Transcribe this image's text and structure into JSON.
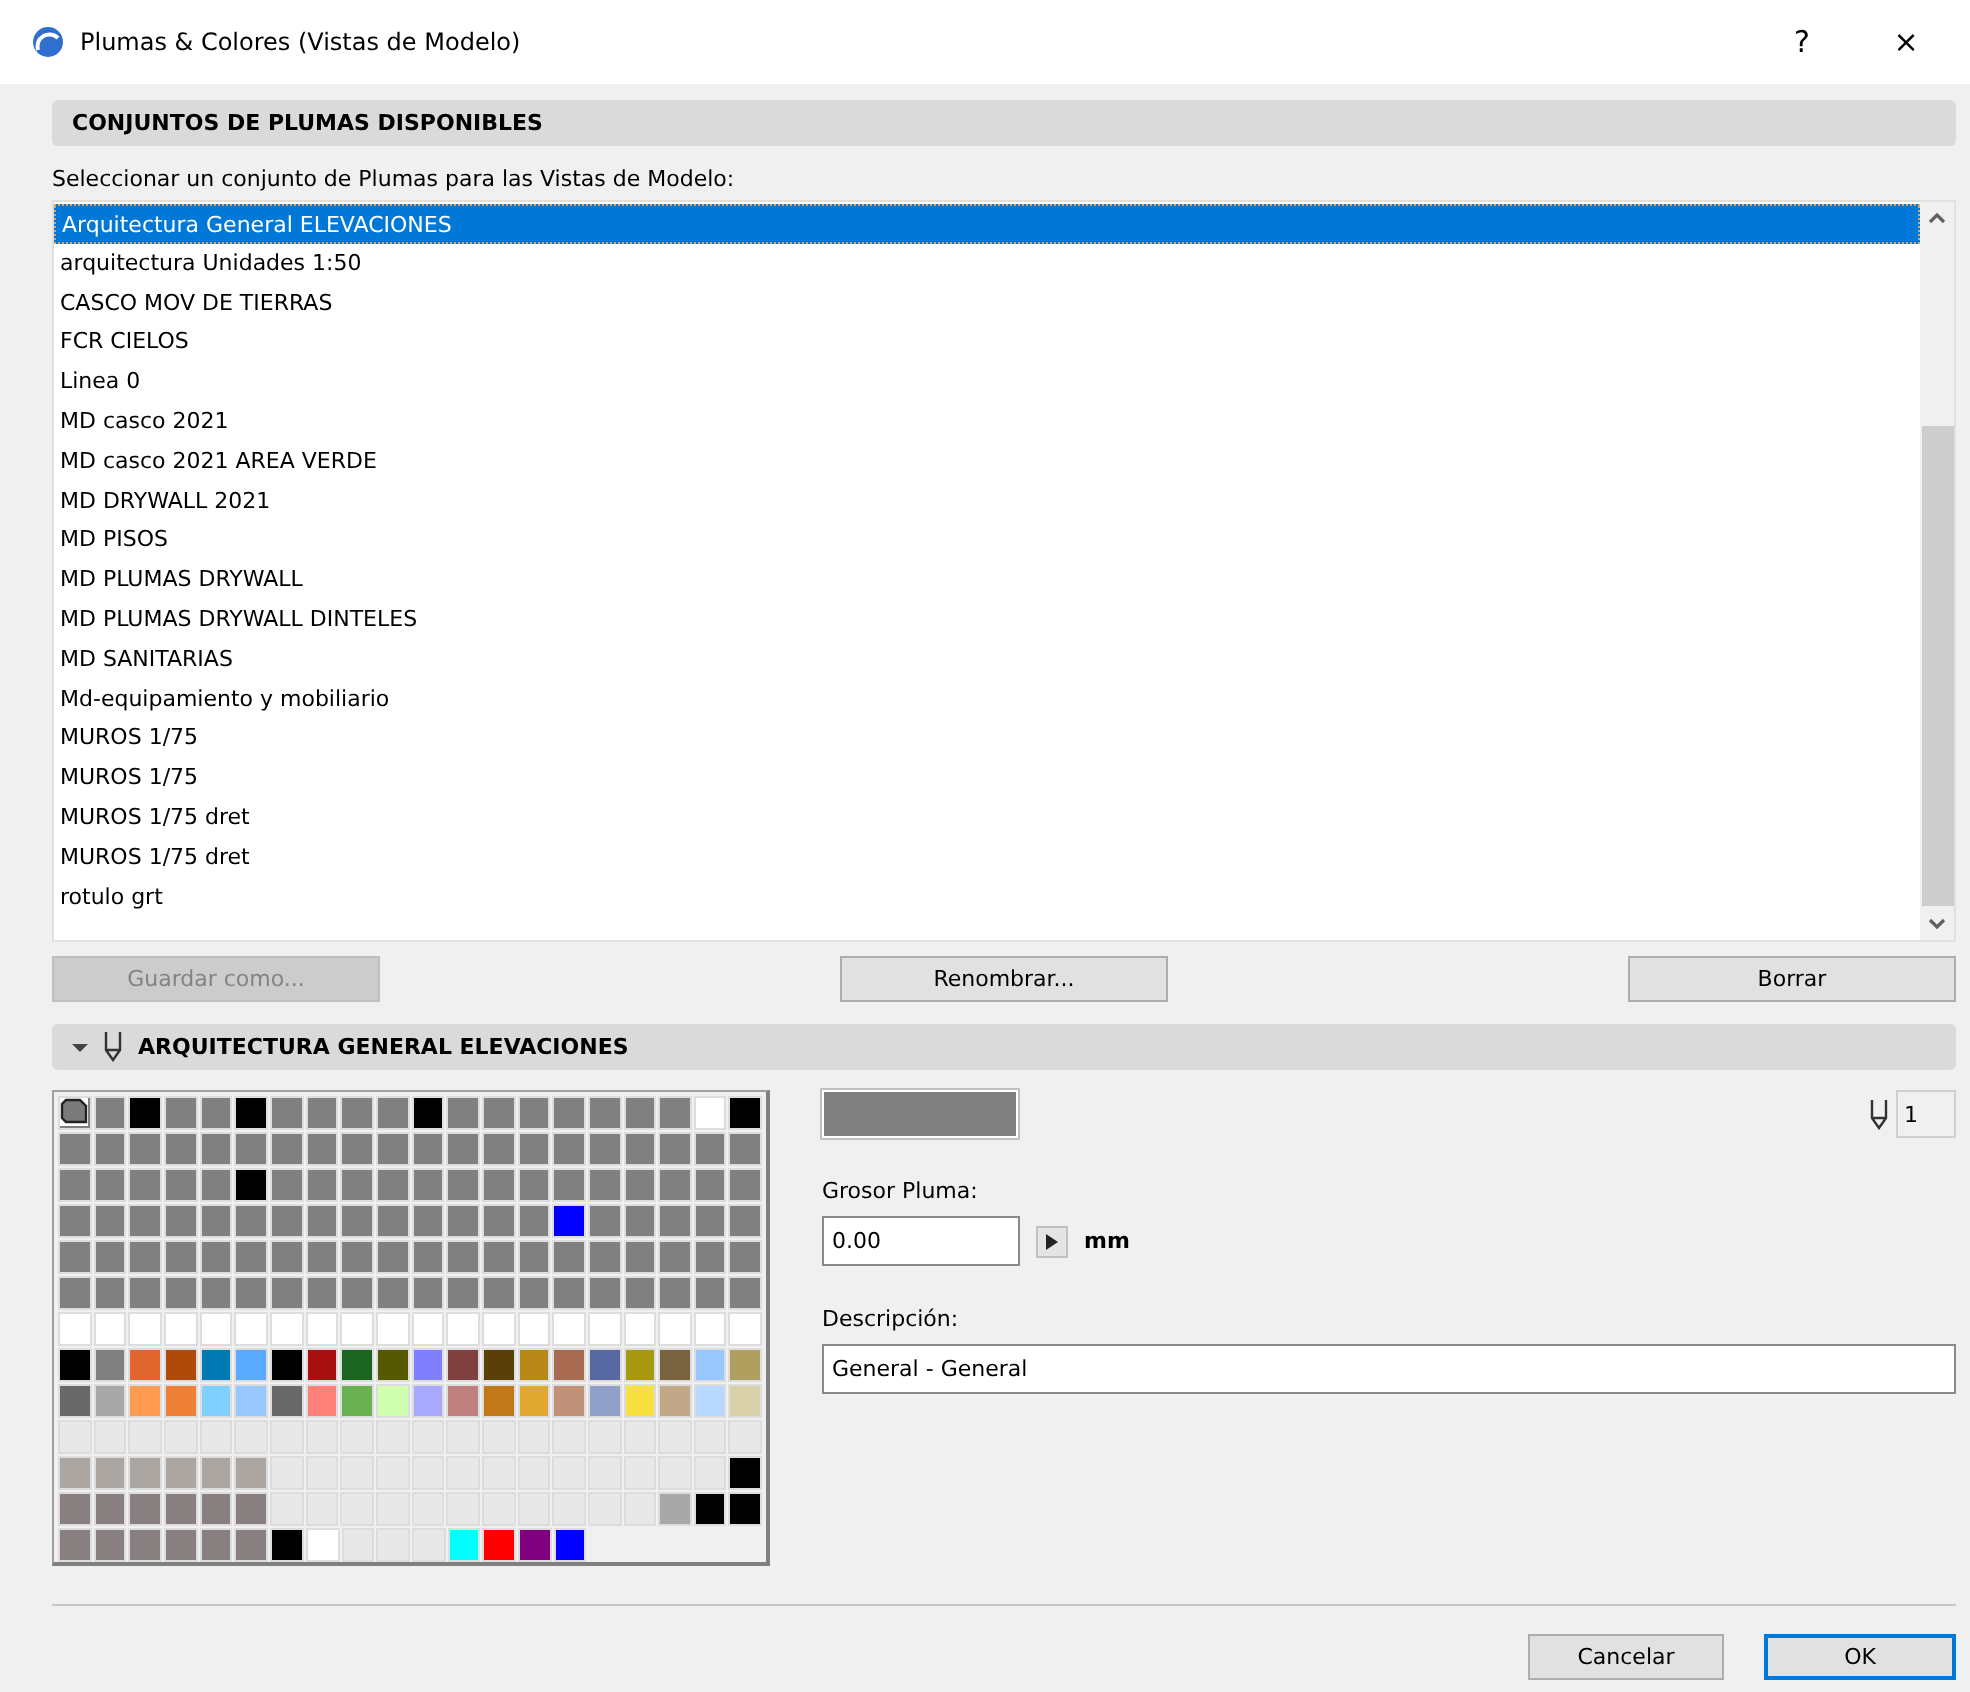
{
  "window": {
    "title": "Plumas & Colores (Vistas de Modelo)",
    "help": "?",
    "close": "×"
  },
  "sets_section": {
    "title": "CONJUNTOS DE PLUMAS DISPONIBLES",
    "prompt": "Seleccionar un conjunto de Plumas para las Vistas de Modelo:"
  },
  "pen_sets": [
    {
      "label": "Arquitectura General ELEVACIONES",
      "selected": true
    },
    {
      "label": "arquitectura Unidades 1:50",
      "selected": false
    },
    {
      "label": "CASCO MOV DE TIERRAS",
      "selected": false
    },
    {
      "label": "FCR CIELOS",
      "selected": false
    },
    {
      "label": "Linea 0",
      "selected": false
    },
    {
      "label": "MD casco 2021",
      "selected": false
    },
    {
      "label": "MD casco 2021 AREA VERDE",
      "selected": false
    },
    {
      "label": "MD DRYWALL 2021",
      "selected": false
    },
    {
      "label": "MD PISOS",
      "selected": false
    },
    {
      "label": "MD PLUMAS DRYWALL",
      "selected": false
    },
    {
      "label": "MD PLUMAS DRYWALL DINTELES",
      "selected": false
    },
    {
      "label": "MD SANITARIAS",
      "selected": false
    },
    {
      "label": "Md-equipamiento y mobiliario",
      "selected": false
    },
    {
      "label": "MUROS 1/75",
      "selected": false
    },
    {
      "label": "MUROS 1/75",
      "selected": false
    },
    {
      "label": "MUROS 1/75 dret",
      "selected": false
    },
    {
      "label": "MUROS 1/75 dret",
      "selected": false
    },
    {
      "label": "rotulo grt",
      "selected": false
    }
  ],
  "set_buttons": [
    {
      "label": "Guardar como...",
      "disabled": true
    },
    {
      "label": "Renombrar...",
      "disabled": false
    },
    {
      "label": "Borrar",
      "disabled": false
    }
  ],
  "pen_section": {
    "title": "ARQUITECTURA GENERAL ELEVACIONES",
    "expanded": true
  },
  "pen_palette": {
    "rows": [
      {
        "cells": [
          {
            "color": "#808080",
            "selected": true
          },
          {
            "color": "#808080",
            "selected": false
          },
          {
            "color": "#000000",
            "selected": false
          },
          {
            "color": "#808080",
            "selected": false
          },
          {
            "color": "#808080",
            "selected": false
          },
          {
            "color": "#000000",
            "selected": false
          },
          {
            "color": "#808080",
            "selected": false
          },
          {
            "color": "#808080",
            "selected": false
          },
          {
            "color": "#808080",
            "selected": false
          },
          {
            "color": "#808080",
            "selected": false
          },
          {
            "color": "#000000",
            "selected": false
          },
          {
            "color": "#808080",
            "selected": false
          },
          {
            "color": "#808080",
            "selected": false
          },
          {
            "color": "#808080",
            "selected": false
          },
          {
            "color": "#808080",
            "selected": false
          },
          {
            "color": "#808080",
            "selected": false
          },
          {
            "color": "#808080",
            "selected": false
          },
          {
            "color": "#808080",
            "selected": false
          },
          {
            "color": "#ffffff",
            "selected": false
          },
          {
            "color": "#000000",
            "selected": false
          }
        ]
      },
      {
        "cells": [
          {
            "color": "#808080",
            "selected": false
          },
          {
            "color": "#808080",
            "selected": false
          },
          {
            "color": "#808080",
            "selected": false
          },
          {
            "color": "#808080",
            "selected": false
          },
          {
            "color": "#808080",
            "selected": false
          },
          {
            "color": "#808080",
            "selected": false
          },
          {
            "color": "#808080",
            "selected": false
          },
          {
            "color": "#808080",
            "selected": false
          },
          {
            "color": "#808080",
            "selected": false
          },
          {
            "color": "#808080",
            "selected": false
          },
          {
            "color": "#808080",
            "selected": false
          },
          {
            "color": "#808080",
            "selected": false
          },
          {
            "color": "#808080",
            "selected": false
          },
          {
            "color": "#808080",
            "selected": false
          },
          {
            "color": "#808080",
            "selected": false
          },
          {
            "color": "#808080",
            "selected": false
          },
          {
            "color": "#808080",
            "selected": false
          },
          {
            "color": "#808080",
            "selected": false
          },
          {
            "color": "#808080",
            "selected": false
          },
          {
            "color": "#808080",
            "selected": false
          }
        ]
      },
      {
        "cells": [
          {
            "color": "#808080",
            "selected": false
          },
          {
            "color": "#808080",
            "selected": false
          },
          {
            "color": "#808080",
            "selected": false
          },
          {
            "color": "#808080",
            "selected": false
          },
          {
            "color": "#808080",
            "selected": false
          },
          {
            "color": "#000000",
            "selected": false
          },
          {
            "color": "#808080",
            "selected": false
          },
          {
            "color": "#808080",
            "selected": false
          },
          {
            "color": "#808080",
            "selected": false
          },
          {
            "color": "#808080",
            "selected": false
          },
          {
            "color": "#808080",
            "selected": false
          },
          {
            "color": "#808080",
            "selected": false
          },
          {
            "color": "#808080",
            "selected": false
          },
          {
            "color": "#808080",
            "selected": false
          },
          {
            "color": "#808080",
            "selected": false
          },
          {
            "color": "#808080",
            "selected": false
          },
          {
            "color": "#808080",
            "selected": false
          },
          {
            "color": "#808080",
            "selected": false
          },
          {
            "color": "#808080",
            "selected": false
          },
          {
            "color": "#808080",
            "selected": false
          }
        ]
      },
      {
        "cells": [
          {
            "color": "#808080",
            "selected": false
          },
          {
            "color": "#808080",
            "selected": false
          },
          {
            "color": "#808080",
            "selected": false
          },
          {
            "color": "#808080",
            "selected": false
          },
          {
            "color": "#808080",
            "selected": false
          },
          {
            "color": "#808080",
            "selected": false
          },
          {
            "color": "#808080",
            "selected": false
          },
          {
            "color": "#808080",
            "selected": false
          },
          {
            "color": "#808080",
            "selected": false
          },
          {
            "color": "#808080",
            "selected": false
          },
          {
            "color": "#808080",
            "selected": false
          },
          {
            "color": "#808080",
            "selected": false
          },
          {
            "color": "#808080",
            "selected": false
          },
          {
            "color": "#808080",
            "selected": false
          },
          {
            "color": "#0000ff",
            "selected": false
          },
          {
            "color": "#808080",
            "selected": false
          },
          {
            "color": "#808080",
            "selected": false
          },
          {
            "color": "#808080",
            "selected": false
          },
          {
            "color": "#808080",
            "selected": false
          },
          {
            "color": "#808080",
            "selected": false
          }
        ]
      },
      {
        "cells": [
          {
            "color": "#808080",
            "selected": false
          },
          {
            "color": "#808080",
            "selected": false
          },
          {
            "color": "#808080",
            "selected": false
          },
          {
            "color": "#808080",
            "selected": false
          },
          {
            "color": "#808080",
            "selected": false
          },
          {
            "color": "#808080",
            "selected": false
          },
          {
            "color": "#808080",
            "selected": false
          },
          {
            "color": "#808080",
            "selected": false
          },
          {
            "color": "#808080",
            "selected": false
          },
          {
            "color": "#808080",
            "selected": false
          },
          {
            "color": "#808080",
            "selected": false
          },
          {
            "color": "#808080",
            "selected": false
          },
          {
            "color": "#808080",
            "selected": false
          },
          {
            "color": "#808080",
            "selected": false
          },
          {
            "color": "#808080",
            "selected": false
          },
          {
            "color": "#808080",
            "selected": false
          },
          {
            "color": "#808080",
            "selected": false
          },
          {
            "color": "#808080",
            "selected": false
          },
          {
            "color": "#808080",
            "selected": false
          },
          {
            "color": "#808080",
            "selected": false
          }
        ]
      },
      {
        "cells": [
          {
            "color": "#808080",
            "selected": false
          },
          {
            "color": "#808080",
            "selected": false
          },
          {
            "color": "#808080",
            "selected": false
          },
          {
            "color": "#808080",
            "selected": false
          },
          {
            "color": "#808080",
            "selected": false
          },
          {
            "color": "#808080",
            "selected": false
          },
          {
            "color": "#808080",
            "selected": false
          },
          {
            "color": "#808080",
            "selected": false
          },
          {
            "color": "#808080",
            "selected": false
          },
          {
            "color": "#808080",
            "selected": false
          },
          {
            "color": "#808080",
            "selected": false
          },
          {
            "color": "#808080",
            "selected": false
          },
          {
            "color": "#808080",
            "selected": false
          },
          {
            "color": "#808080",
            "selected": false
          },
          {
            "color": "#808080",
            "selected": false
          },
          {
            "color": "#808080",
            "selected": false
          },
          {
            "color": "#808080",
            "selected": false
          },
          {
            "color": "#808080",
            "selected": false
          },
          {
            "color": "#808080",
            "selected": false
          },
          {
            "color": "#808080",
            "selected": false
          }
        ]
      },
      {
        "cells": [
          {
            "color": "#ffffff",
            "selected": false
          },
          {
            "color": "#ffffff",
            "selected": false
          },
          {
            "color": "#ffffff",
            "selected": false
          },
          {
            "color": "#ffffff",
            "selected": false
          },
          {
            "color": "#ffffff",
            "selected": false
          },
          {
            "color": "#ffffff",
            "selected": false
          },
          {
            "color": "#ffffff",
            "selected": false
          },
          {
            "color": "#ffffff",
            "selected": false
          },
          {
            "color": "#ffffff",
            "selected": false
          },
          {
            "color": "#ffffff",
            "selected": false
          },
          {
            "color": "#ffffff",
            "selected": false
          },
          {
            "color": "#ffffff",
            "selected": false
          },
          {
            "color": "#ffffff",
            "selected": false
          },
          {
            "color": "#ffffff",
            "selected": false
          },
          {
            "color": "#ffffff",
            "selected": false
          },
          {
            "color": "#ffffff",
            "selected": false
          },
          {
            "color": "#ffffff",
            "selected": false
          },
          {
            "color": "#ffffff",
            "selected": false
          },
          {
            "color": "#ffffff",
            "selected": false
          },
          {
            "color": "#ffffff",
            "selected": false
          }
        ]
      },
      {
        "cells": [
          {
            "color": "#000000",
            "selected": false
          },
          {
            "color": "#808080",
            "selected": false
          },
          {
            "color": "#e0662e",
            "selected": false
          },
          {
            "color": "#b04a0a",
            "selected": false
          },
          {
            "color": "#0078b4",
            "selected": false
          },
          {
            "color": "#5aaaff",
            "selected": false
          },
          {
            "color": "#000000",
            "selected": false
          },
          {
            "color": "#a81010",
            "selected": false
          },
          {
            "color": "#1a6620",
            "selected": false
          },
          {
            "color": "#555a00",
            "selected": false
          },
          {
            "color": "#8080ff",
            "selected": false
          },
          {
            "color": "#804040",
            "selected": false
          },
          {
            "color": "#5a4008",
            "selected": false
          },
          {
            "color": "#b88818",
            "selected": false
          },
          {
            "color": "#a86a50",
            "selected": false
          },
          {
            "color": "#5868a0",
            "selected": false
          },
          {
            "color": "#a89810",
            "selected": false
          },
          {
            "color": "#7a6440",
            "selected": false
          },
          {
            "color": "#98c8ff",
            "selected": false
          },
          {
            "color": "#b0a060",
            "selected": false
          }
        ]
      },
      {
        "cells": [
          {
            "color": "#686868",
            "selected": false
          },
          {
            "color": "#a8a8a8",
            "selected": false
          },
          {
            "color": "#ff9a50",
            "selected": false
          },
          {
            "color": "#f08038",
            "selected": false
          },
          {
            "color": "#80d0ff",
            "selected": false
          },
          {
            "color": "#98c8ff",
            "selected": false
          },
          {
            "color": "#686868",
            "selected": false
          },
          {
            "color": "#ff8078",
            "selected": false
          },
          {
            "color": "#68b050",
            "selected": false
          },
          {
            "color": "#d0ffb0",
            "selected": false
          },
          {
            "color": "#a8a8ff",
            "selected": false
          },
          {
            "color": "#c08080",
            "selected": false
          },
          {
            "color": "#c07818",
            "selected": false
          },
          {
            "color": "#e0a830",
            "selected": false
          },
          {
            "color": "#c09078",
            "selected": false
          },
          {
            "color": "#90a0c8",
            "selected": false
          },
          {
            "color": "#f8e040",
            "selected": false
          },
          {
            "color": "#c0a888",
            "selected": false
          },
          {
            "color": "#b8d8ff",
            "selected": false
          },
          {
            "color": "#d8d0a8",
            "selected": false
          }
        ]
      },
      {
        "cells": [
          {
            "color": "#e8e8e8",
            "selected": false
          },
          {
            "color": "#e8e8e8",
            "selected": false
          },
          {
            "color": "#e8e8e8",
            "selected": false
          },
          {
            "color": "#e8e8e8",
            "selected": false
          },
          {
            "color": "#e8e8e8",
            "selected": false
          },
          {
            "color": "#e8e8e8",
            "selected": false
          },
          {
            "color": "#e8e8e8",
            "selected": false
          },
          {
            "color": "#e8e8e8",
            "selected": false
          },
          {
            "color": "#e8e8e8",
            "selected": false
          },
          {
            "color": "#e8e8e8",
            "selected": false
          },
          {
            "color": "#e8e8e8",
            "selected": false
          },
          {
            "color": "#e8e8e8",
            "selected": false
          },
          {
            "color": "#e8e8e8",
            "selected": false
          },
          {
            "color": "#e8e8e8",
            "selected": false
          },
          {
            "color": "#e8e8e8",
            "selected": false
          },
          {
            "color": "#e8e8e8",
            "selected": false
          },
          {
            "color": "#e8e8e8",
            "selected": false
          },
          {
            "color": "#e8e8e8",
            "selected": false
          },
          {
            "color": "#e8e8e8",
            "selected": false
          },
          {
            "color": "#e8e8e8",
            "selected": false
          }
        ]
      },
      {
        "cells": [
          {
            "color": "#aca6a2",
            "selected": false
          },
          {
            "color": "#aca6a2",
            "selected": false
          },
          {
            "color": "#aca6a2",
            "selected": false
          },
          {
            "color": "#aca6a2",
            "selected": false
          },
          {
            "color": "#aca6a2",
            "selected": false
          },
          {
            "color": "#aca6a2",
            "selected": false
          },
          {
            "color": "#e8e8e8",
            "selected": false
          },
          {
            "color": "#e8e8e8",
            "selected": false
          },
          {
            "color": "#e8e8e8",
            "selected": false
          },
          {
            "color": "#e8e8e8",
            "selected": false
          },
          {
            "color": "#e8e8e8",
            "selected": false
          },
          {
            "color": "#e8e8e8",
            "selected": false
          },
          {
            "color": "#e8e8e8",
            "selected": false
          },
          {
            "color": "#e8e8e8",
            "selected": false
          },
          {
            "color": "#e8e8e8",
            "selected": false
          },
          {
            "color": "#e8e8e8",
            "selected": false
          },
          {
            "color": "#e8e8e8",
            "selected": false
          },
          {
            "color": "#e8e8e8",
            "selected": false
          },
          {
            "color": "#e8e8e8",
            "selected": false
          },
          {
            "color": "#000000",
            "selected": false
          }
        ]
      },
      {
        "cells": [
          {
            "color": "#888080",
            "selected": false
          },
          {
            "color": "#888080",
            "selected": false
          },
          {
            "color": "#888080",
            "selected": false
          },
          {
            "color": "#888080",
            "selected": false
          },
          {
            "color": "#888080",
            "selected": false
          },
          {
            "color": "#888080",
            "selected": false
          },
          {
            "color": "#e8e8e8",
            "selected": false
          },
          {
            "color": "#e8e8e8",
            "selected": false
          },
          {
            "color": "#e8e8e8",
            "selected": false
          },
          {
            "color": "#e8e8e8",
            "selected": false
          },
          {
            "color": "#e8e8e8",
            "selected": false
          },
          {
            "color": "#e8e8e8",
            "selected": false
          },
          {
            "color": "#e8e8e8",
            "selected": false
          },
          {
            "color": "#e8e8e8",
            "selected": false
          },
          {
            "color": "#e8e8e8",
            "selected": false
          },
          {
            "color": "#e8e8e8",
            "selected": false
          },
          {
            "color": "#e8e8e8",
            "selected": false
          },
          {
            "color": "#a8a8a8",
            "selected": false
          },
          {
            "color": "#000000",
            "selected": false
          },
          {
            "color": "#000000",
            "selected": false
          }
        ]
      },
      {
        "cells": [
          {
            "color": "#888080",
            "selected": false
          },
          {
            "color": "#888080",
            "selected": false
          },
          {
            "color": "#888080",
            "selected": false
          },
          {
            "color": "#888080",
            "selected": false
          },
          {
            "color": "#888080",
            "selected": false
          },
          {
            "color": "#888080",
            "selected": false
          },
          {
            "color": "#000000",
            "selected": false
          },
          {
            "color": "#ffffff",
            "selected": false
          },
          {
            "color": "#e8e8e8",
            "selected": false
          },
          {
            "color": "#e8e8e8",
            "selected": false
          },
          {
            "color": "#e8e8e8",
            "selected": false
          },
          {
            "color": "#00ffff",
            "selected": false
          },
          {
            "color": "#ff0000",
            "selected": false
          },
          {
            "color": "#800080",
            "selected": false
          },
          {
            "color": "#0000ff",
            "selected": false
          }
        ]
      }
    ]
  },
  "pen_details": {
    "color": "#808080",
    "pen_number": "1",
    "thickness_label": "Grosor Pluma:",
    "thickness": "0.00",
    "unit": "mm",
    "description_label": "Descripción:",
    "description": "General - General"
  },
  "footer_buttons": [
    {
      "label": "Cancelar",
      "default": false
    },
    {
      "label": "OK",
      "default": true
    }
  ]
}
